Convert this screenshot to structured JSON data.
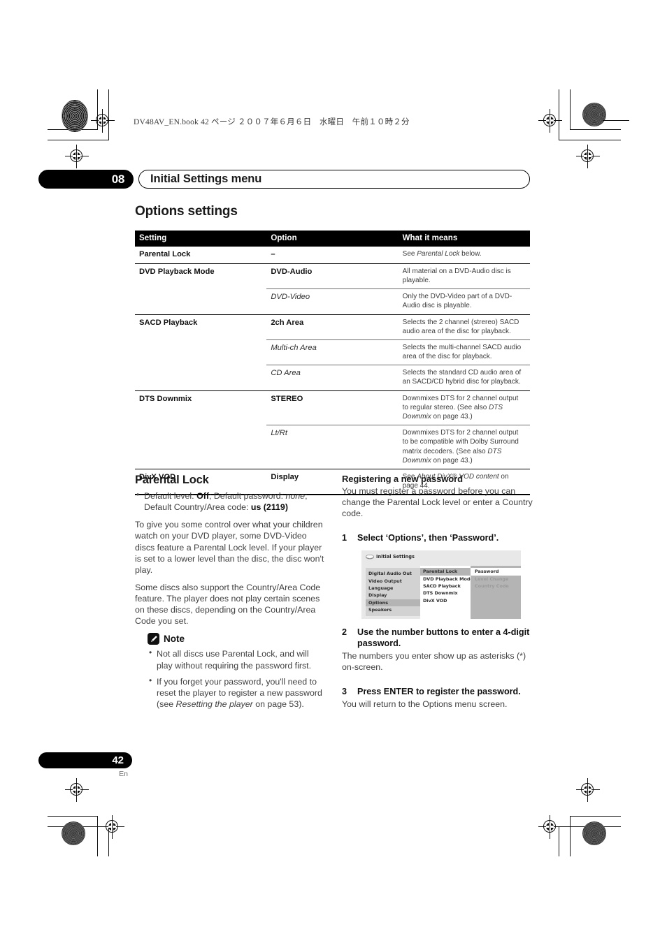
{
  "page": {
    "header_line": "DV48AV_EN.book   42 ページ   ２００７年６月６日　水曜日　午前１０時２分",
    "chapter_number": "08",
    "chapter_title": "Initial Settings menu",
    "page_number": "42",
    "language_code": "En"
  },
  "section": {
    "title": "Options settings"
  },
  "table": {
    "headers": [
      "Setting",
      "Option",
      "What it means"
    ],
    "rows": [
      {
        "setting": "Parental Lock",
        "options": [
          {
            "option": "–",
            "style": "bold",
            "means_pre": "See ",
            "means_em": "Parental Lock",
            "means_post": " below."
          }
        ]
      },
      {
        "setting": "DVD Playback Mode",
        "options": [
          {
            "option": "DVD-Audio",
            "style": "bold",
            "means_pre": "All material on a DVD-Audio disc is playable.",
            "means_em": "",
            "means_post": ""
          },
          {
            "option": "DVD-Video",
            "style": "italic",
            "means_pre": "Only the DVD-Video part of a DVD-Audio disc is playable.",
            "means_em": "",
            "means_post": ""
          }
        ]
      },
      {
        "setting": "SACD Playback",
        "options": [
          {
            "option": "2ch Area",
            "style": "bold",
            "means_pre": "Selects the 2 channel (strereo) SACD audio area of the disc for playback.",
            "means_em": "",
            "means_post": ""
          },
          {
            "option": "Multi-ch Area",
            "style": "italic",
            "means_pre": "Selects the multi-channel SACD audio area of the disc for playback.",
            "means_em": "",
            "means_post": ""
          },
          {
            "option": "CD Area",
            "style": "italic",
            "means_pre": "Selects the standard CD audio area of an SACD/CD hybrid disc for playback.",
            "means_em": "",
            "means_post": ""
          }
        ]
      },
      {
        "setting": "DTS Downmix",
        "options": [
          {
            "option": "STEREO",
            "style": "bold",
            "means_pre": "Downmixes DTS for 2 channel output to regular stereo. (See also ",
            "means_em": "DTS Downmix",
            "means_post": " on page 43.)"
          },
          {
            "option": "Lt/Rt",
            "style": "italic",
            "means_pre": "Downmixes DTS for 2 channel output to be compatible with Dolby Surround matrix decoders. (See also ",
            "means_em": "DTS Downmix",
            "means_post": " on page 43.)"
          }
        ]
      },
      {
        "setting": "DivX VOD",
        "options": [
          {
            "option": "Display",
            "style": "bold",
            "means_pre": "See ",
            "means_em": "About DivX® VOD content",
            "means_post": " on page 44."
          }
        ]
      }
    ]
  },
  "parental_lock": {
    "heading": "Parental Lock",
    "default_bullet_pre": "Default level: ",
    "default_bullet_off": "Off",
    "default_bullet_mid": "; Default password: ",
    "default_bullet_none": "none",
    "default_bullet_mid2": "; Default Country/Area code: ",
    "default_bullet_code": "us (2119)",
    "para1": "To give you some control over what your children watch on your DVD player, some DVD-Video discs feature a Parental Lock level. If your player is set to a lower level than the disc, the disc won't play.",
    "para2": "Some discs also support the Country/Area Code feature. The player does not play certain scenes on these discs, depending on the Country/Area Code you set."
  },
  "note": {
    "label": "Note",
    "items_plain": [
      "Not all discs use Parental Lock, and will play without requiring the password first."
    ],
    "item2_pre": "If you forget your password, you'll need to reset the player to register a new password (see ",
    "item2_em": "Resetting the player",
    "item2_post": " on page 53)."
  },
  "registering": {
    "heading": "Registering a new password",
    "intro": "You must register a password before you can change the Parental Lock level or enter a Country code.",
    "steps": [
      {
        "num": "1",
        "text": "Select ‘Options’, then ‘Password’."
      },
      {
        "num": "2",
        "text": "Use the number buttons to enter a 4-digit password.",
        "body": "The numbers you enter show up as asterisks (*) on-screen."
      },
      {
        "num": "3",
        "text": "Press ENTER to register the password.",
        "body": "You will return to the Options menu screen."
      }
    ]
  },
  "osd": {
    "title": "Initial Settings",
    "column1": [
      {
        "label": "Digital Audio Out",
        "state": "normal"
      },
      {
        "label": "Video Output",
        "state": "normal"
      },
      {
        "label": "Language",
        "state": "normal"
      },
      {
        "label": "Display",
        "state": "normal"
      },
      {
        "label": "Options",
        "state": "selected"
      },
      {
        "label": "Speakers",
        "state": "normal"
      }
    ],
    "column2": [
      {
        "label": "Parental Lock",
        "state": "selected"
      },
      {
        "label": "DVD Playback Mode",
        "state": "normal"
      },
      {
        "label": "SACD Playback",
        "state": "normal"
      },
      {
        "label": "DTS Downmix",
        "state": "normal"
      },
      {
        "label": "DivX VOD",
        "state": "normal"
      }
    ],
    "column3": [
      {
        "label": "Password",
        "state": "selected"
      },
      {
        "label": "Level Change",
        "state": "dimmed"
      },
      {
        "label": "Country Code",
        "state": "dimmed"
      }
    ]
  },
  "colors": {
    "ink": "#000000",
    "body_text": "#404040",
    "osd_background": "#e8e8e8",
    "osd_panel_light": "#d2d2d2",
    "osd_panel_gray": "#b4b4b4",
    "osd_panel_white": "#ffffff",
    "osd_dim_text": "#9a9a9a"
  }
}
